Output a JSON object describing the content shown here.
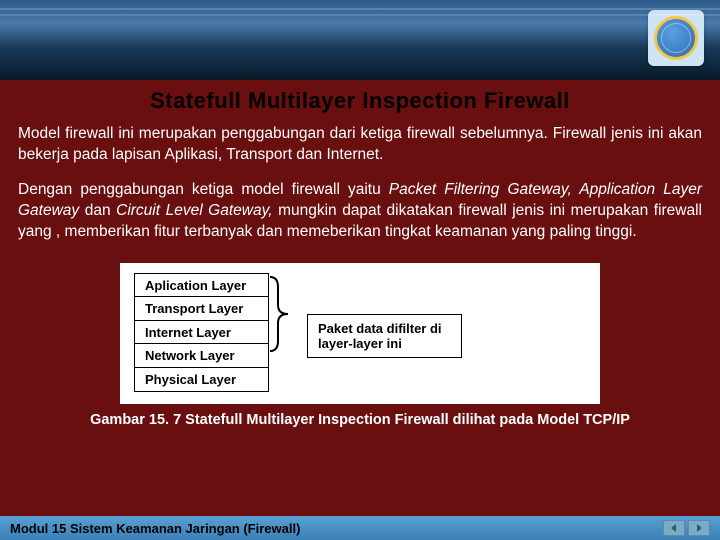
{
  "title": "Statefull Multilayer Inspection Firewall",
  "paragraph1": "Model firewall ini merupakan penggabungan dari ketiga firewall sebelumnya. Firewall jenis ini akan bekerja pada lapisan Aplikasi, Transport dan Internet.",
  "paragraph2_part1": "Dengan penggabungan ketiga model firewall yaitu ",
  "paragraph2_italic": "Packet Filtering Gateway, Application Layer Gateway ",
  "paragraph2_part2": "dan ",
  "paragraph2_italic2": "Circuit Level Gateway, ",
  "paragraph2_part3": "mungkin dapat dikatakan firewall jenis ini merupakan firewall yang , memberikan fitur terbanyak dan memeberikan tingkat keamanan yang paling tinggi.",
  "layers": [
    "Aplication Layer",
    "Transport Layer",
    "Internet  Layer",
    "Network  Layer",
    "Physical Layer"
  ],
  "filter_label": "Paket data difilter di layer-layer ini",
  "caption": "Gambar 15. 7 Statefull Multilayer Inspection Firewall dilihat pada Model TCP/IP",
  "footer": "Modul 15 Sistem Keamanan Jaringan (Firewall)"
}
